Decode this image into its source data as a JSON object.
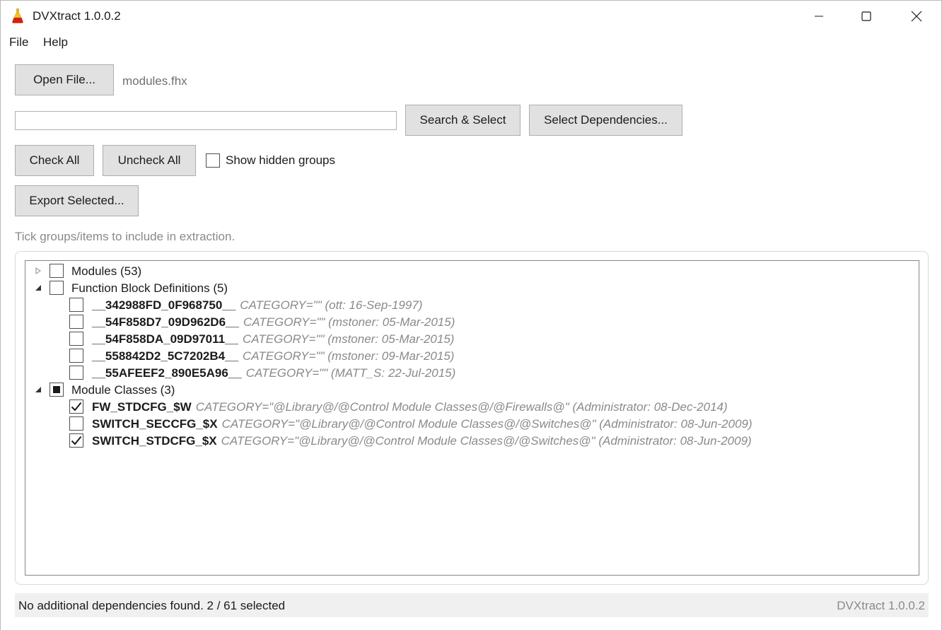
{
  "window": {
    "title": "DVXtract 1.0.0.2",
    "icon": "flask-icon"
  },
  "menu": {
    "file": "File",
    "help": "Help"
  },
  "toolbar": {
    "open_file_label": "Open File...",
    "loaded_file": "modules.fhx",
    "search_value": "",
    "search_select_label": "Search & Select",
    "select_dependencies_label": "Select Dependencies...",
    "check_all_label": "Check All",
    "uncheck_all_label": "Uncheck All",
    "show_hidden_label": "Show hidden groups",
    "show_hidden_checked": false,
    "export_selected_label": "Export Selected..."
  },
  "hint": "Tick groups/items to include in extraction.",
  "tree": {
    "groups": [
      {
        "label": "Modules (53)",
        "expanded": false,
        "state": "unchecked",
        "items": []
      },
      {
        "label": "Function Block Definitions (5)",
        "expanded": true,
        "state": "unchecked",
        "items": [
          {
            "name": "__342988FD_0F968750__",
            "meta": "CATEGORY=\"\" (ott: 16-Sep-1997)",
            "checked": false
          },
          {
            "name": "__54F858D7_09D962D6__",
            "meta": "CATEGORY=\"\" (mstoner: 05-Mar-2015)",
            "checked": false
          },
          {
            "name": "__54F858DA_09D97011__",
            "meta": "CATEGORY=\"\" (mstoner: 05-Mar-2015)",
            "checked": false
          },
          {
            "name": "__558842D2_5C7202B4__",
            "meta": "CATEGORY=\"\" (mstoner: 09-Mar-2015)",
            "checked": false
          },
          {
            "name": "__55AFEEF2_890E5A96__",
            "meta": "CATEGORY=\"\" (MATT_S: 22-Jul-2015)",
            "checked": false
          }
        ]
      },
      {
        "label": "Module Classes (3)",
        "expanded": true,
        "state": "indeterminate",
        "items": [
          {
            "name": "FW_STDCFG_$W",
            "meta": "CATEGORY=\"@Library@/@Control Module Classes@/@Firewalls@\" (Administrator: 08-Dec-2014)",
            "checked": true
          },
          {
            "name": "SWITCH_SECCFG_$X",
            "meta": "CATEGORY=\"@Library@/@Control Module Classes@/@Switches@\" (Administrator: 08-Jun-2009)",
            "checked": false
          },
          {
            "name": "SWITCH_STDCFG_$X",
            "meta": "CATEGORY=\"@Library@/@Control Module Classes@/@Switches@\" (Administrator: 08-Jun-2009)",
            "checked": true
          }
        ]
      }
    ]
  },
  "status": {
    "message": "No additional dependencies found.  2 / 61 selected",
    "version": "DVXtract 1.0.0.2"
  }
}
